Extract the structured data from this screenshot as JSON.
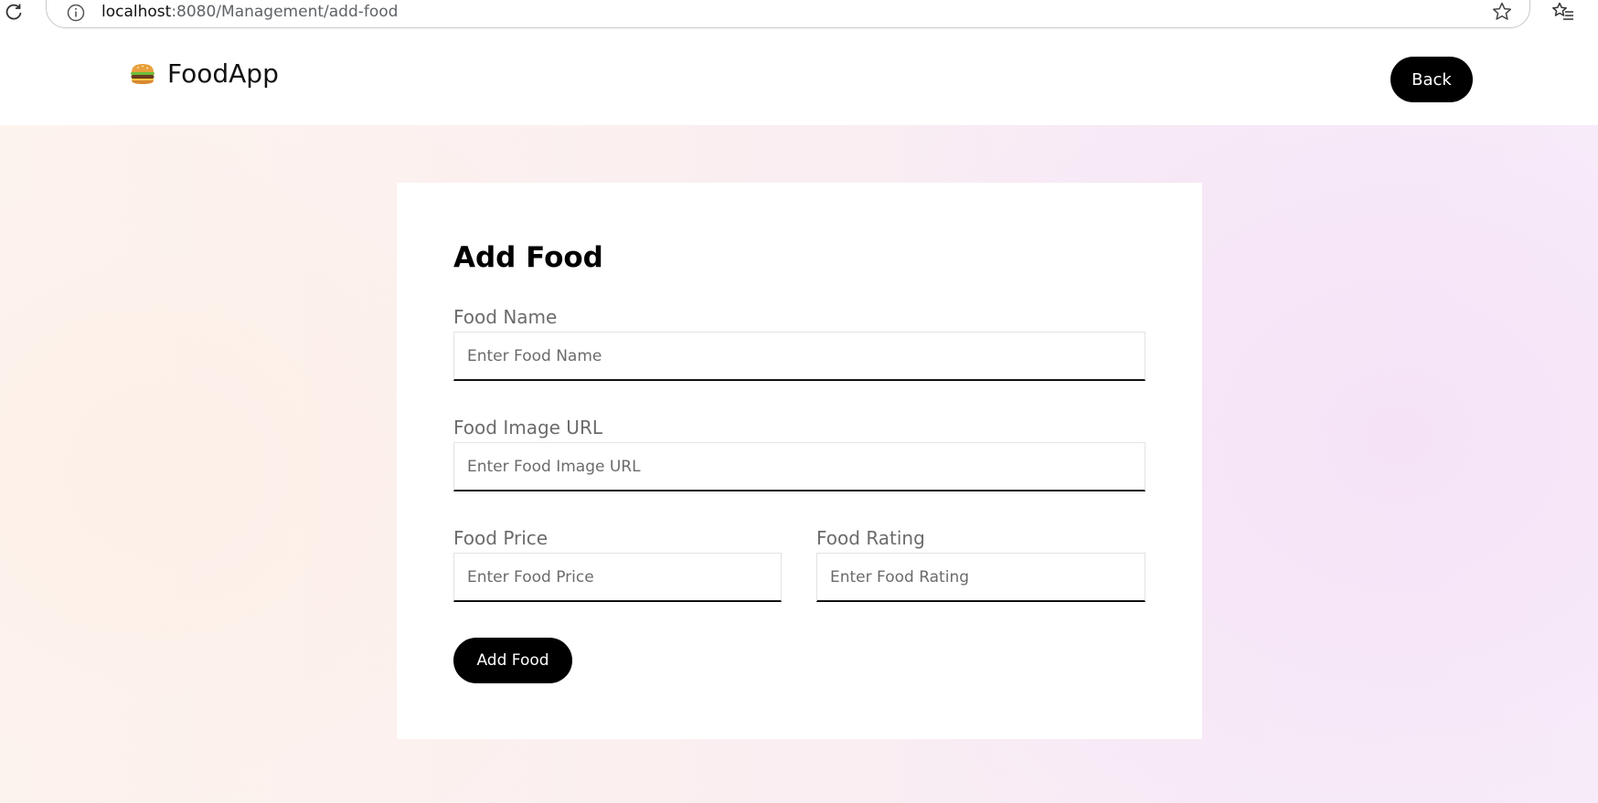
{
  "browser": {
    "url_host": "localhost",
    "url_rest": ":8080/Management/add-food",
    "icons": [
      "reload-icon",
      "info-icon",
      "star-icon",
      "favorites-icon"
    ]
  },
  "header": {
    "logo_icon": "burger-icon",
    "logo_text": "FoodApp",
    "back_label": "Back"
  },
  "form": {
    "title": "Add Food",
    "food_name": {
      "label": "Food Name",
      "placeholder": "Enter Food Name",
      "value": ""
    },
    "food_image_url": {
      "label": "Food Image URL",
      "placeholder": "Enter Food Image URL",
      "value": ""
    },
    "food_price": {
      "label": "Food Price",
      "placeholder": "Enter Food Price",
      "value": ""
    },
    "food_rating": {
      "label": "Food Rating",
      "placeholder": "Enter Food Rating",
      "value": ""
    },
    "submit_label": "Add Food"
  },
  "colors": {
    "button_bg": "#000000",
    "button_text": "#ffffff",
    "label": "#6b6b6b",
    "input_underline": "#111111"
  }
}
